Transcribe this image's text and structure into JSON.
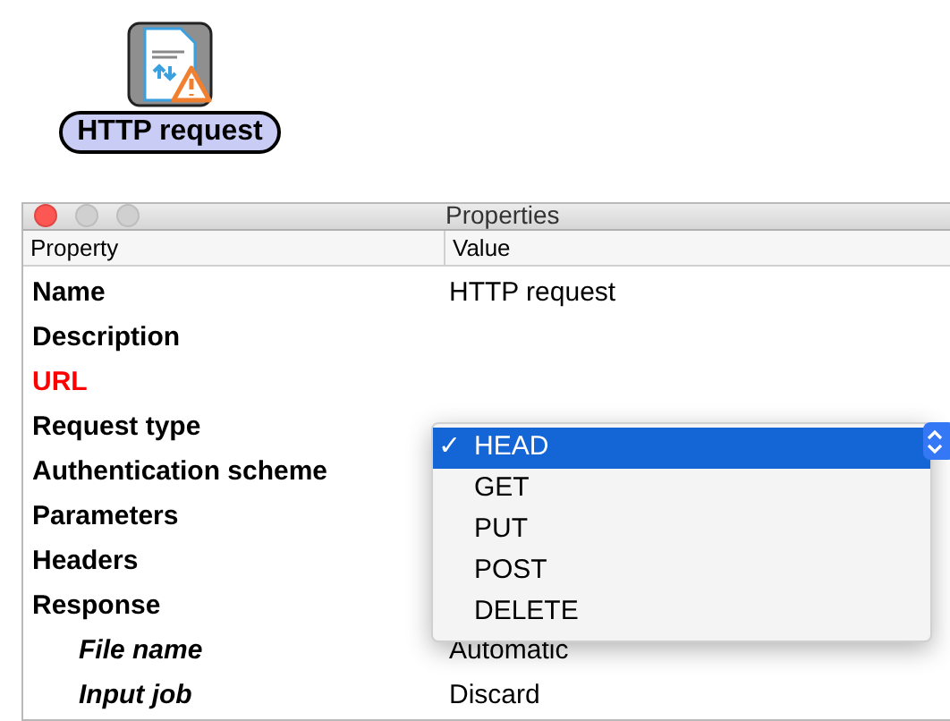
{
  "node": {
    "label": "HTTP request"
  },
  "window": {
    "title": "Properties"
  },
  "columns": [
    "Property",
    "Value"
  ],
  "rows": [
    {
      "property": "Name",
      "kind": "bold",
      "value": "HTTP request"
    },
    {
      "property": "Description",
      "kind": "bold"
    },
    {
      "property": "URL",
      "kind": "required"
    },
    {
      "property": "Request type",
      "kind": "bold"
    },
    {
      "property": "Authentication scheme",
      "kind": "bold"
    },
    {
      "property": "Parameters",
      "kind": "bold"
    },
    {
      "property": "Headers",
      "kind": "bold"
    },
    {
      "property": "Response",
      "kind": "bold"
    },
    {
      "property": "File name",
      "kind": "sub",
      "value": "Automatic"
    },
    {
      "property": "Input job",
      "kind": "sub",
      "value": "Discard"
    }
  ],
  "popup_menu": {
    "check": "✓",
    "options": [
      {
        "label": "HEAD",
        "selected": true
      },
      {
        "label": "GET",
        "selected": false
      },
      {
        "label": "PUT",
        "selected": false
      },
      {
        "label": "POST",
        "selected": false
      },
      {
        "label": "DELETE",
        "selected": false
      }
    ]
  }
}
